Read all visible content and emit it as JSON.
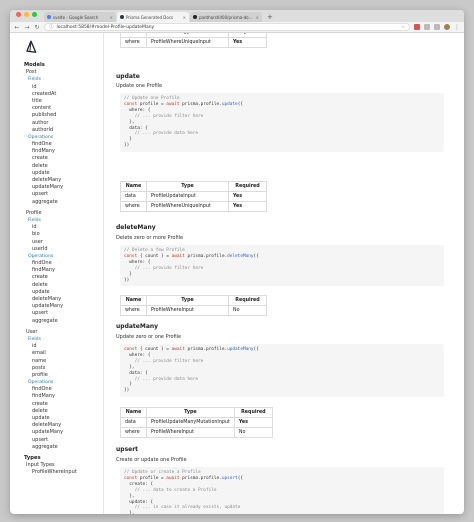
{
  "browser": {
    "tabs": [
      {
        "label": "svelte - Google Search",
        "active": false
      },
      {
        "label": "Prisma Generated Docs",
        "active": true
      },
      {
        "label": "pantharshit00/prisma-docs-g...",
        "active": false
      }
    ],
    "url": "localhost:5858/#model-Profile-updateMany",
    "traffic": [
      "#fc5f57",
      "#fdbc2e",
      "#28c840"
    ]
  },
  "sidebar": {
    "models_heading": "Models",
    "models": [
      {
        "name": "Post",
        "fields_label": "Fields",
        "fields": [
          "id",
          "createdAt",
          "title",
          "content",
          "published",
          "author",
          "authorId"
        ],
        "operations_label": "Operations",
        "operations": [
          "findOne",
          "findMany",
          "create",
          "delete",
          "update",
          "deleteMany",
          "updateMany",
          "upsert",
          "aggregate"
        ]
      },
      {
        "name": "Profile",
        "fields_label": "Fields",
        "fields": [
          "id",
          "bio",
          "user",
          "userId"
        ],
        "operations_label": "Operations",
        "operations": [
          "findOne",
          "findMany",
          "create",
          "delete",
          "update",
          "deleteMany",
          "updateMany",
          "upsert",
          "aggregate"
        ]
      },
      {
        "name": "User",
        "fields_label": "Fields",
        "fields": [
          "id",
          "email",
          "name",
          "posts",
          "profile"
        ],
        "operations_label": "Operations",
        "operations": [
          "findOne",
          "findMany",
          "create",
          "delete",
          "update",
          "deleteMany",
          "updateMany",
          "upsert",
          "aggregate"
        ]
      }
    ],
    "types_heading": "Types",
    "input_types_label": "Input Types",
    "input_types": [
      "ProfileWhereInput"
    ]
  },
  "table_headers": {
    "name": "Name",
    "type": "Type",
    "required": "Required"
  },
  "top_table": {
    "rows": [
      {
        "name": "where",
        "type": "ProfileWhereUniqueInput",
        "required": "Yes"
      }
    ]
  },
  "sections": [
    {
      "id": "update",
      "title": "update",
      "desc": "Update one Profile",
      "code": [
        {
          "t": "cm",
          "s": "// Update one Profile"
        },
        {
          "t": "mix",
          "a": "const",
          "b": " profile = ",
          "c": "await",
          "d": " prisma.profile.",
          "e": "update",
          "f": "({"
        },
        {
          "t": "pl",
          "s": "  where: {"
        },
        {
          "t": "cm",
          "s": "    // ... provide filter here"
        },
        {
          "t": "pl",
          "s": "  },"
        },
        {
          "t": "pl",
          "s": "  data: {"
        },
        {
          "t": "cm",
          "s": "    // ... provide data here"
        },
        {
          "t": "pl",
          "s": "  }"
        },
        {
          "t": "pl",
          "s": "})"
        }
      ],
      "rows": [
        {
          "name": "data",
          "type": "ProfileUpdateInput",
          "required": "Yes"
        },
        {
          "name": "where",
          "type": "ProfileWhereUniqueInput",
          "required": "Yes"
        }
      ]
    },
    {
      "id": "deleteMany",
      "title": "deleteMany",
      "desc": "Delete zero or more Profile",
      "code": [
        {
          "t": "cm",
          "s": "// Delete a few Profile"
        },
        {
          "t": "mix",
          "a": "const",
          "b": " { count } = ",
          "c": "await",
          "d": " prisma.profile.",
          "e": "deleteMany",
          "f": "({"
        },
        {
          "t": "pl",
          "s": "  where: {"
        },
        {
          "t": "cm",
          "s": "    // ... provide filter here"
        },
        {
          "t": "pl",
          "s": "  }"
        },
        {
          "t": "pl",
          "s": "})"
        }
      ],
      "rows": [
        {
          "name": "where",
          "type": "ProfileWhereInput",
          "required": "No"
        }
      ]
    },
    {
      "id": "updateMany",
      "title": "updateMany",
      "desc": "Update zero or one Profile",
      "code": [
        {
          "t": "mix",
          "a": "const",
          "b": " { count } = ",
          "c": "await",
          "d": " prisma.profile.",
          "e": "updateMany",
          "f": "({"
        },
        {
          "t": "pl",
          "s": "  where: {"
        },
        {
          "t": "cm",
          "s": "    // ... provide filter here"
        },
        {
          "t": "pl",
          "s": "  },"
        },
        {
          "t": "pl",
          "s": "  data: {"
        },
        {
          "t": "cm",
          "s": "    // ... provide data here"
        },
        {
          "t": "pl",
          "s": "  }"
        },
        {
          "t": "pl",
          "s": "})"
        }
      ],
      "rows": [
        {
          "name": "data",
          "type": "ProfileUpdateManyMutationInput",
          "required": "Yes"
        },
        {
          "name": "where",
          "type": "ProfileWhereInput",
          "required": "No"
        }
      ]
    },
    {
      "id": "upsert",
      "title": "upsert",
      "desc": "Create or update one Profile",
      "code": [
        {
          "t": "cm",
          "s": "// Update or create a Profile"
        },
        {
          "t": "mix",
          "a": "const",
          "b": " profile = ",
          "c": "await",
          "d": " prisma.profile.",
          "e": "upsert",
          "f": "({"
        },
        {
          "t": "pl",
          "s": "  create: {"
        },
        {
          "t": "cm",
          "s": "    // ... data to create a Profile"
        },
        {
          "t": "pl",
          "s": "  },"
        },
        {
          "t": "pl",
          "s": "  update: {"
        },
        {
          "t": "cm",
          "s": "    // ... in case it already exists, update"
        },
        {
          "t": "pl",
          "s": "  },"
        },
        {
          "t": "pl",
          "s": "  where: {"
        },
        {
          "t": "cm",
          "s": "    // ... the filter for the Profile we want to update"
        },
        {
          "t": "pl",
          "s": "  }"
        }
      ],
      "rows": []
    }
  ]
}
